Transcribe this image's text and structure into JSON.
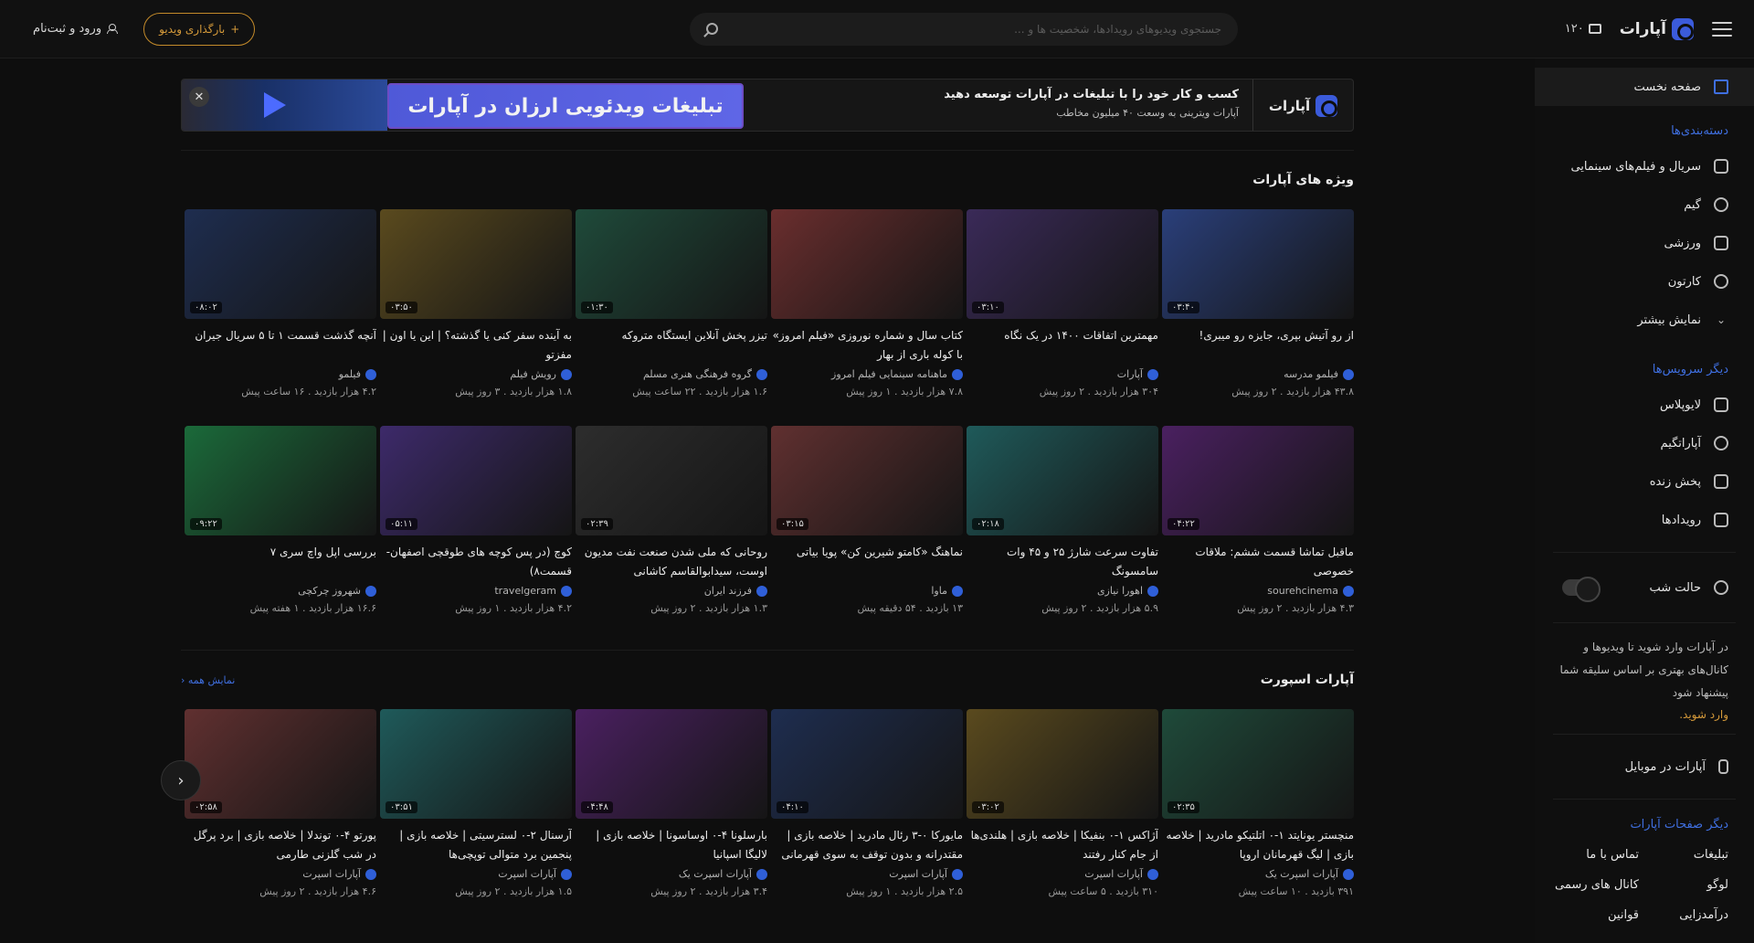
{
  "header": {
    "logo_text": "آپارات",
    "counter": "۱۲۰",
    "search_placeholder": "جستجوی ویدیوهای رویدادها، شخصیت ها و ...",
    "upload_label": "بارگذاری ویدیو",
    "login_label": "ورود و ثبت‌نام"
  },
  "sidebar": {
    "home": "صفحه نخست",
    "categories_title": "دسته‌بندی‌ها",
    "categories": [
      "سریال و فیلم‌های سینمایی",
      "گیم",
      "ورزشی",
      "کارتون",
      "نمایش بیشتر"
    ],
    "services_title": "دیگر سرویس‌ها",
    "services": [
      "لایوپلاس",
      "آپاراتگیم",
      "پخش زنده",
      "رویدادها"
    ],
    "night_mode": "حالت شب",
    "note": "در آپارات وارد شوید تا ویدیوها و کانال‌های بهتری بر اساس سلیقه شما پیشنهاد شود",
    "login_link": "وارد شوید.",
    "mobile": "آپارات در موبایل",
    "pages_title": "دیگر صفحات آپارات",
    "pages": [
      "تبلیغات",
      "تماس با ما",
      "لوگو",
      "کانال های رسمی",
      "درآمدزایی",
      "قوانین"
    ]
  },
  "banner": {
    "brand": "آپارات",
    "headline": "کسب و کار خود را با تبلیغات در آپارات توسعه دهید",
    "subline": "آپارات ویترینی به وسعت ۴۰ میلیون مخاطب",
    "cta": "تبلیغات ویدئویی ارزان در آپارات",
    "close": "✕"
  },
  "featured": {
    "title": "ویژه های آپارات",
    "rows": [
      [
        {
          "title": "از رو آتیش بپری، جایزه رو میبری!",
          "channel": "فیلمو مدرسه",
          "views": "۴۳.۸ هزار بازدید",
          "age": "۲ روز پیش",
          "duration": "۰۳:۴۰"
        },
        {
          "title": "مهمترین اتفاقات ۱۴۰۰ در یک نگاه",
          "channel": "آپارات",
          "views": "۳۰۴ هزار بازدید",
          "age": "۲ روز پیش",
          "duration": "۰۳:۱۰"
        },
        {
          "title": "کتاب سال و شماره نوروزی «فیلم امروز» با کوله باری از بهار",
          "channel": "ماهنامه سینمایی فیلم امروز",
          "views": "۷.۸ هزار بازدید",
          "age": "۱ روز پیش",
          "duration": ""
        },
        {
          "title": "تیزر پخش آنلاین ایستگاه متروکه",
          "channel": "گروه فرهنگی هنری مسلم",
          "views": "۱.۶ هزار بازدید",
          "age": "۲۲ ساعت پیش",
          "duration": "۰۱:۳۰"
        },
        {
          "title": "به آینده سفر کنی یا گذشته؟ | این یا اون | مفزتو",
          "channel": "رویش فیلم",
          "views": "۱.۸ هزار بازدید",
          "age": "۳ روز پیش",
          "duration": "۰۳:۵۰"
        },
        {
          "title": "آنچه گذشت قسمت ۱ تا ۵ سریال جیران",
          "channel": "فیلمو",
          "views": "۴.۲ هزار بازدید",
          "age": "۱۶ ساعت پیش",
          "duration": "۰۸:۰۲"
        }
      ],
      [
        {
          "title": "ماقبل تماشا قسمت ششم: ملاقات خصوصی",
          "channel": "sourehcinema",
          "views": "۴.۳ هزار بازدید",
          "age": "۲ روز پیش",
          "duration": "۰۴:۲۲"
        },
        {
          "title": "تفاوت سرعت شارژ ۲۵ و ۴۵ وات سامسونگ",
          "channel": "اهورا نیازی",
          "views": "۵.۹ هزار بازدید",
          "age": "۲ روز پیش",
          "duration": "۰۲:۱۸"
        },
        {
          "title": "نماهنگ «کامتو شیرین کن» پویا بیاتی",
          "channel": "ماوا",
          "views": "۱۳ بازدید",
          "age": "۵۴ دقیقه پیش",
          "duration": "۰۳:۱۵"
        },
        {
          "title": "روحانی که ملی شدن صنعت نفت مدیون اوست، سیدابوالقاسم کاشانی",
          "channel": "فرزند ایران",
          "views": "۱.۳ هزار بازدید",
          "age": "۲ روز پیش",
          "duration": "۰۲:۳۹"
        },
        {
          "title": "کوچ (در پس کوچه های طوقچی اصفهان- قسمت۸)",
          "channel": "travelgeram",
          "views": "۴.۲ هزار بازدید",
          "age": "۱ روز پیش",
          "duration": "۰۵:۱۱"
        },
        {
          "title": "بررسی اپل واچ سری ۷",
          "channel": "شهروز چرکچی",
          "views": "۱۶.۶ هزار بازدید",
          "age": "۱ هفته پیش",
          "duration": "۰۹:۲۲"
        }
      ]
    ]
  },
  "sport": {
    "title": "آپارات اسپورت",
    "show_all": "نمایش همه",
    "items": [
      {
        "title": "منچستر یونایتد ۱-۰ اتلتیکو مادرید | خلاصه بازی | لیگ قهرمانان اروپا",
        "channel": "آپارات اسپرت یک",
        "views": "۳۹۱ بازدید",
        "age": "۱۰ ساعت پیش",
        "duration": "۰۲:۳۵"
      },
      {
        "title": "آژاکس ۱-۰ بنفیکا | خلاصه بازی | هلندی‌ها از جام کنار رفتند",
        "channel": "آپارات اسپرت",
        "views": "۳۱۰ بازدید",
        "age": "۵ ساعت پیش",
        "duration": "۰۳:۰۲"
      },
      {
        "title": "مایورکا ۰-۳ رئال مادرید | خلاصه بازی | مقتدرانه و بدون توقف به سوی قهرمانی",
        "channel": "آپارات اسپرت",
        "views": "۲.۵ هزار بازدید",
        "age": "۱ روز پیش",
        "duration": "۰۴:۱۰"
      },
      {
        "title": "بارسلونا ۴-۰ اوساسونا | خلاصه بازی | لالیگا اسپانیا",
        "channel": "آپارات اسپرت یک",
        "views": "۳.۴ هزار بازدید",
        "age": "۲ روز پیش",
        "duration": "۰۴:۴۸"
      },
      {
        "title": "آرسنال ۲-۰ لسترسیتی | خلاصه بازی | پنجمین برد متوالی توپچی‌ها",
        "channel": "آپارات اسپرت",
        "views": "۱.۵ هزار بازدید",
        "age": "۲ روز پیش",
        "duration": "۰۳:۵۱"
      },
      {
        "title": "پورتو ۴-۰ توندلا | خلاصه بازی | برد پرگل در شب گلزنی طارمی",
        "channel": "آپارات اسپرت",
        "views": "۴.۶ هزار بازدید",
        "age": "۲ روز پیش",
        "duration": "۰۲:۵۸"
      }
    ]
  },
  "thumb_colors": [
    "#2a3f7a",
    "#3a2a58",
    "#6a2e2e",
    "#1f4a3a",
    "#5a4a1e",
    "#1e2d4f",
    "#4a2060",
    "#1f5a5a",
    "#603030",
    "#2d2d2d",
    "#3d2a6a",
    "#1b6a3a"
  ]
}
